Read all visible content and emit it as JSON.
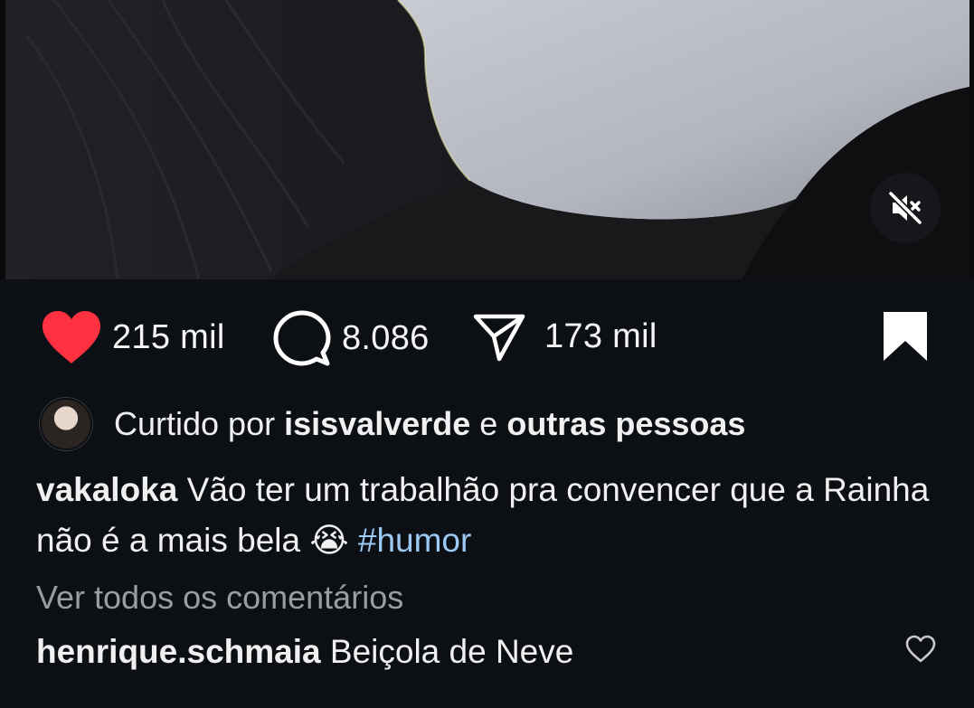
{
  "post": {
    "media": {
      "mute_icon": "speaker-muted-icon"
    },
    "actions": {
      "likes": "215 mil",
      "comments": "8.086",
      "shares": "173 mil",
      "like_icon": "heart-filled-icon",
      "comment_icon": "speech-bubble-icon",
      "share_icon": "paper-plane-icon",
      "save_icon": "bookmark-filled-icon",
      "like_color": "#ff3040"
    },
    "liked_by": {
      "prefix": "Curtido por",
      "user": "isisvalverde",
      "connector": "e",
      "others": "outras pessoas"
    },
    "caption": {
      "user": "vakaloka",
      "text": "Vão ter um trabalhão pra convencer que a Rainha não é a mais bela 😭",
      "hashtag": "#humor"
    },
    "view_all_comments": "Ver todos os comentários",
    "top_comment": {
      "user": "henrique.schmaia",
      "text": "Beiçola de Neve",
      "heart_icon": "heart-outline-icon"
    }
  }
}
